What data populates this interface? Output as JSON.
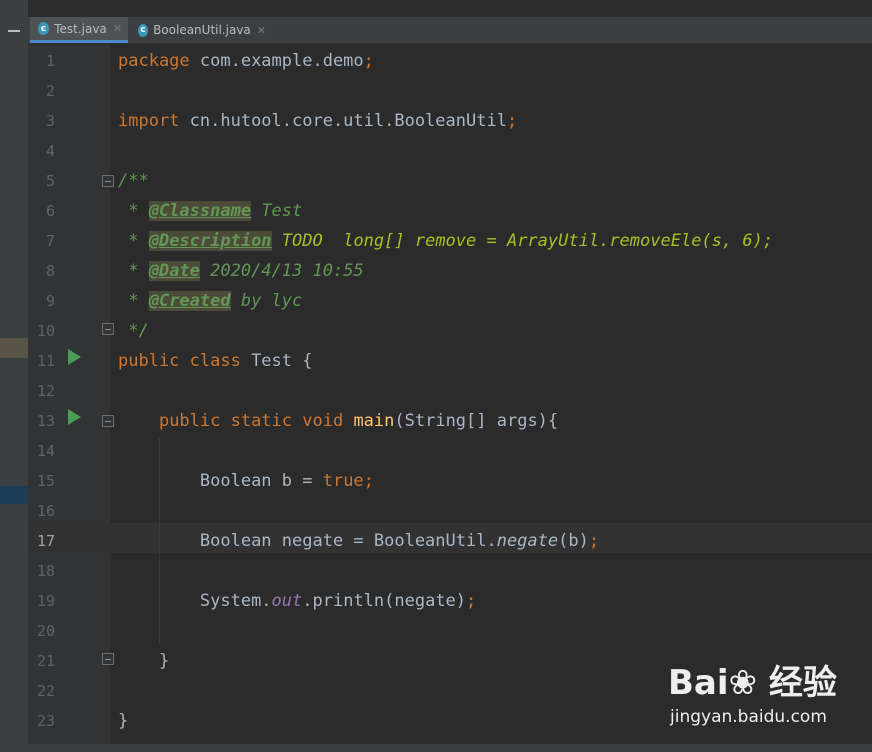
{
  "tabs": [
    {
      "label": "Test.java",
      "icon": "java-class-icon"
    },
    {
      "label": "BooleanUtil.java",
      "icon": "java-class-icon"
    }
  ],
  "line_numbers": [
    "1",
    "2",
    "3",
    "4",
    "5",
    "6",
    "7",
    "8",
    "9",
    "10",
    "11",
    "12",
    "13",
    "14",
    "15",
    "16",
    "17",
    "18",
    "19",
    "20",
    "21",
    "22",
    "23"
  ],
  "current_line": "17",
  "code": {
    "l1": {
      "kw": "package",
      "rest": " com.example.demo",
      "semi": ";"
    },
    "l3": {
      "kw": "import",
      "rest": " cn.hutool.core.util.BooleanUtil",
      "semi": ";"
    },
    "l5": {
      "text": "/**"
    },
    "l6": {
      "star": " * ",
      "tag": "@Classname",
      "rest": " Test"
    },
    "l7": {
      "star": " * ",
      "tag": "@Description",
      "sp": " ",
      "todo": "TODO  long[] remove = ArrayUtil.removeEle(s, 6);"
    },
    "l8": {
      "star": " * ",
      "tag": "@Date",
      "rest": " 2020/4/13 10:55"
    },
    "l9": {
      "star": " * ",
      "tag": "@Created",
      "rest": " by lyc"
    },
    "l10": {
      "text": " */"
    },
    "l11": {
      "kw": "public class",
      "rest": " Test {"
    },
    "l13": {
      "indent": "    ",
      "kw": "public static void",
      "sp": " ",
      "fn": "main",
      "rest": "(String[] args){"
    },
    "l15": {
      "indent": "        ",
      "rest": "Boolean b = ",
      "kw": "true",
      "semi": ";"
    },
    "l17": {
      "indent": "        ",
      "rest": "Boolean negate = BooleanUtil.",
      "st": "negate",
      "args": "(b)",
      "semi": ";"
    },
    "l19": {
      "indent": "        ",
      "rest": "System.",
      "fld": "out",
      "rest2": ".println(negate)",
      "semi": ";"
    },
    "l21": {
      "text": "    }"
    },
    "l23": {
      "text": "}"
    }
  },
  "watermark": {
    "logo": "Bai❀ 经验",
    "url": "jingyan.baidu.com"
  },
  "colors": {
    "keyword": "#cc7832",
    "method": "#ffc66d",
    "doc": "#629755",
    "todo": "#a8c023",
    "field": "#9876aa",
    "text": "#a9b7c6"
  }
}
